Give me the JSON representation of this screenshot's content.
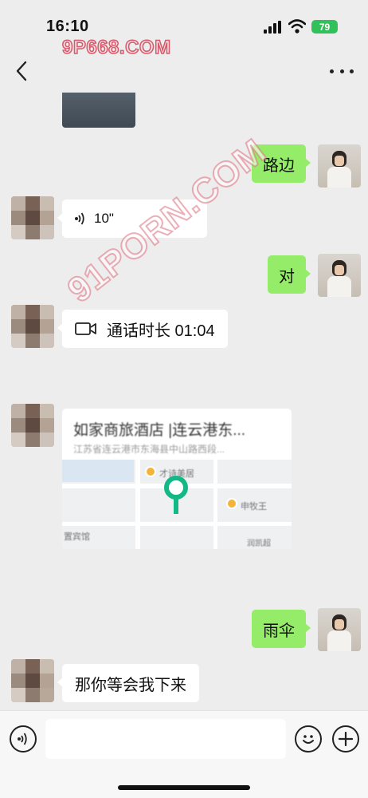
{
  "status_bar": {
    "time": "16:10",
    "battery": "79"
  },
  "watermarks": {
    "top": "9P668.COM",
    "diagonal": "91PORN.COM"
  },
  "messages": [
    {
      "type": "text",
      "sender": "self",
      "text": "路边"
    },
    {
      "type": "voice",
      "sender": "other",
      "duration": "10\""
    },
    {
      "type": "text",
      "sender": "self",
      "text": "对"
    },
    {
      "type": "call",
      "sender": "other",
      "text": "通话时长 01:04"
    },
    {
      "type": "location",
      "sender": "other",
      "title": "如家商旅酒店 |连云港东...",
      "address": "江苏省连云港市东海县中山路西段..."
    },
    {
      "type": "text",
      "sender": "self",
      "text": "雨伞"
    },
    {
      "type": "text",
      "sender": "other",
      "text": "那你等会我下来"
    }
  ],
  "map": {
    "labels": [
      "才诗美居",
      "申牧王",
      "置宾馆",
      "润凯超"
    ]
  },
  "icons": {
    "back": "chevron-left-icon",
    "more": "more-dots-icon",
    "voice": "voice-wave-icon",
    "video": "video-camera-icon",
    "emoji": "smiley-icon",
    "plus": "plus-icon",
    "pin": "location-pin-icon"
  },
  "colors": {
    "self_bubble": "#95ec69",
    "other_bubble": "#ffffff",
    "background": "#ededed",
    "pin": "#12b886"
  }
}
